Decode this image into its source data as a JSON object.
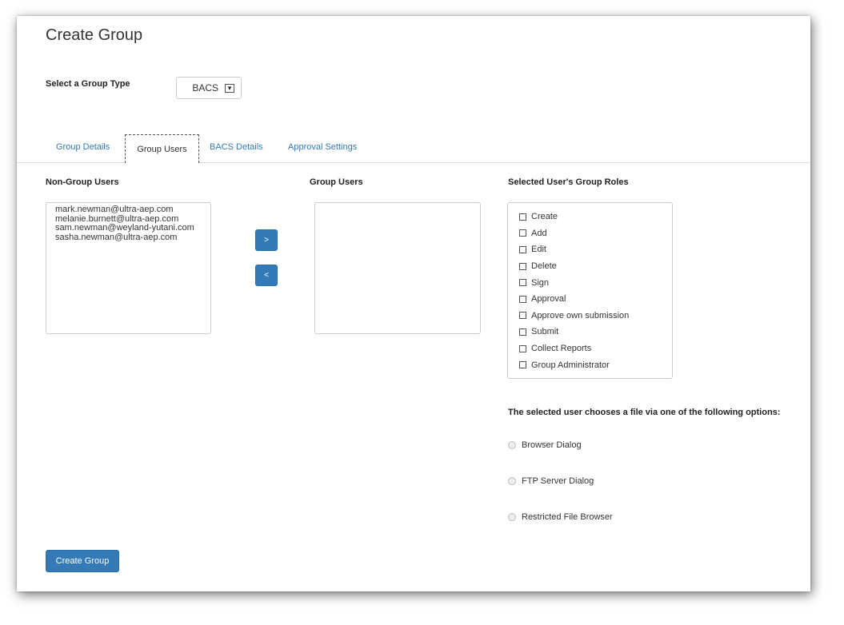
{
  "page": {
    "title": "Create Group"
  },
  "group_type": {
    "label": "Select a Group Type",
    "selected": "BACS"
  },
  "tabs": [
    {
      "label": "Group Details"
    },
    {
      "label": "Group Users"
    },
    {
      "label": "BACS Details"
    },
    {
      "label": "Approval Settings"
    }
  ],
  "non_group": {
    "heading": "Non-Group Users",
    "users": [
      "mark.newman@ultra-aep.com",
      "melanie.burnett@ultra-aep.com",
      "sam.newman@weyland-yutani.com",
      "sasha.newman@ultra-aep.com"
    ]
  },
  "move_buttons": {
    "add": ">",
    "remove": "<"
  },
  "group_users": {
    "heading": "Group Users"
  },
  "roles": {
    "heading": "Selected User's Group Roles",
    "items": [
      "Create",
      "Add",
      "Edit",
      "Delete",
      "Sign",
      "Approval",
      "Approve own submission",
      "Submit",
      "Collect Reports",
      "Group Administrator"
    ]
  },
  "file_options": {
    "heading": "The selected user chooses a file via one of the following options:",
    "items": [
      "Browser Dialog",
      "FTP Server Dialog",
      "Restricted File Browser"
    ]
  },
  "submit": {
    "label": "Create Group"
  },
  "colors": {
    "accent": "#337ab7"
  }
}
